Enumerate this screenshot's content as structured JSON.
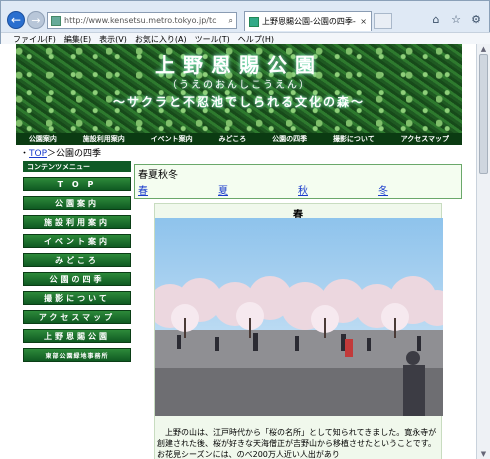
{
  "browser": {
    "url": "http://www.kensetsu.metro.tokyo.jp/tc",
    "tab_title": "上野恩賜公園-公園の四季-",
    "menu": [
      "ファイル(F)",
      "編集(E)",
      "表示(V)",
      "お気に入り(A)",
      "ツール(T)",
      "ヘルプ(H)"
    ]
  },
  "banner": {
    "title": "上野恩賜公園",
    "reading": "（うえのおんしこうえん）",
    "tagline": "〜サクラと不忍池でしられる文化の森〜"
  },
  "global_nav": [
    "公園案内",
    "施設利用案内",
    "イベント案内",
    "みどころ",
    "公園の四季",
    "撮影について",
    "アクセスマップ"
  ],
  "breadcrumb": {
    "bullet": "・",
    "top": "TOP",
    "sep": "＞",
    "current": "公園の四季"
  },
  "sidebar": {
    "heading": "コンテンツメニュー",
    "items": [
      "T O P",
      "公園案内",
      "施設利用案内",
      "イベント案内",
      "みどころ",
      "公園の四季",
      "撮影について",
      "アクセスマップ",
      "上野恩賜公園",
      "東部公園緑地事務所"
    ]
  },
  "seasons": {
    "label": "春夏秋冬",
    "links": [
      "春",
      "夏",
      "秋",
      "冬"
    ]
  },
  "spring": {
    "title": "春",
    "text": "上野の山は、江戸時代から「桜の名所」として知られてきました。寛永寺が創建された後、桜が好きな天海僧正が吉野山から移植させたということです。お花見シーズンには、のべ200万人近い人出があり"
  }
}
